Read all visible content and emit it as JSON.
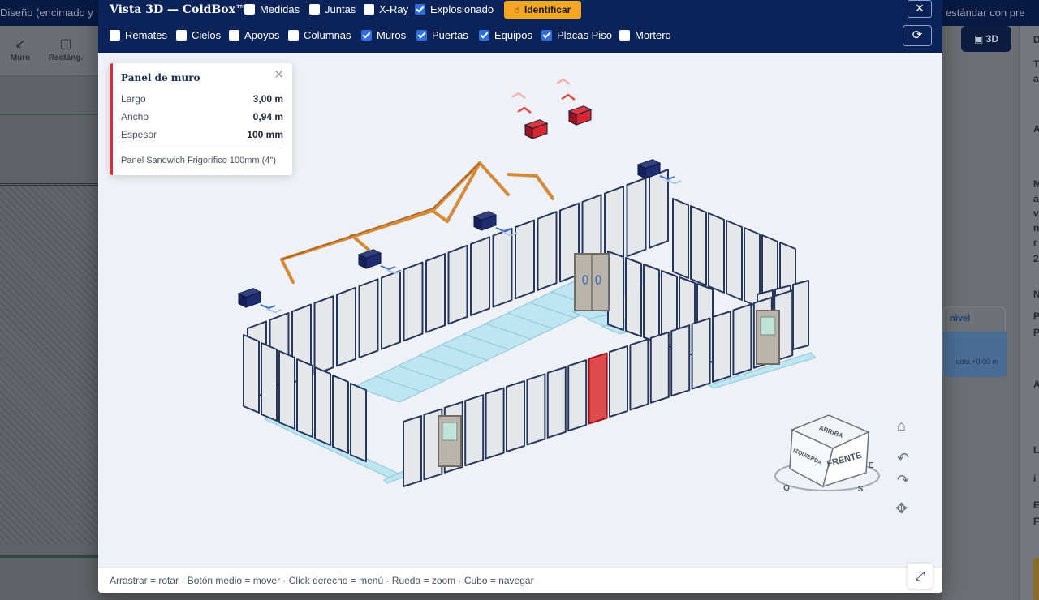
{
  "background": {
    "topbar_left_text": "Diseño (encimado y ",
    "topbar_right_text": "estándar con pre",
    "tools": [
      {
        "label": "Muro",
        "icon": "diagonal-line-icon"
      },
      {
        "label": "Rectáng.",
        "icon": "rectangle-icon"
      }
    ],
    "view3d_label": "3D",
    "nivel_header": "nivel",
    "nivel_cota": "cota +0.00 m",
    "right_letters": [
      "D",
      "T",
      "a",
      "A",
      "M",
      "a",
      "v",
      "n",
      "r",
      "2",
      "N",
      "P",
      "P",
      "A",
      "L",
      "i",
      "E",
      "F"
    ]
  },
  "modal": {
    "title": "Vista 3D — ColdBox™",
    "row1_toggles": [
      {
        "label": "Medidas",
        "checked": false
      },
      {
        "label": "Juntas",
        "checked": false
      },
      {
        "label": "X-Ray",
        "checked": false
      },
      {
        "label": "Explosionado",
        "checked": true
      }
    ],
    "identify_label": "Identificar",
    "close_label": "×",
    "row2_toggles": [
      {
        "label": "Remates",
        "checked": false
      },
      {
        "label": "Cielos",
        "checked": false
      },
      {
        "label": "Apoyos",
        "checked": false
      },
      {
        "label": "Columnas",
        "checked": false
      },
      {
        "label": "Muros",
        "checked": true
      },
      {
        "label": "Puertas",
        "checked": true
      },
      {
        "label": "Equipos",
        "checked": true
      },
      {
        "label": "Placas Piso",
        "checked": true
      },
      {
        "label": "Mortero",
        "checked": false
      }
    ],
    "info_panel": {
      "title": "Panel de muro",
      "rows": [
        {
          "label": "Largo",
          "value": "3,00 m"
        },
        {
          "label": "Ancho",
          "value": "0,94 m"
        },
        {
          "label": "Espesor",
          "value": "100 mm"
        }
      ],
      "description": "Panel Sandwich Frigorífico 100mm (4\")"
    },
    "navcube": {
      "faces": [
        "ARRIBA",
        "FRENTE",
        "IZQUIERDA"
      ],
      "compass": [
        "O",
        "S",
        "E"
      ]
    },
    "footer_hint": "Arrastrar = rotar · Botón medio = mover · Click derecho = menú · Rueda = zoom · Cubo = navegar",
    "colors": {
      "header": "#0b2358",
      "accent": "#f5a623",
      "panel_fill": "#e6e7ea",
      "panel_edge": "#26375f",
      "selected_panel": "#e04b4b",
      "floor": "#bde6f2",
      "equipment": "#1e2d70",
      "beam": "#d58a3a"
    }
  }
}
